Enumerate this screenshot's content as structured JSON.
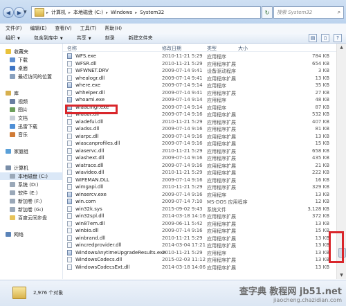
{
  "address": {
    "crumbs": [
      "计算机",
      "本地磁盘 (C:)",
      "Windows",
      "System32"
    ],
    "search_placeholder": "搜索 System32"
  },
  "menu": [
    "文件(F)",
    "编辑(E)",
    "查看(V)",
    "工具(T)",
    "帮助(H)"
  ],
  "toolbar": {
    "organize": "组织",
    "include": "包含到库中",
    "share": "共享",
    "burn": "刻录",
    "new_folder": "新建文件夹"
  },
  "nav": {
    "favorites": "收藏夹",
    "download": "下载",
    "desktop": "桌面",
    "recent": "最近访问的位置",
    "library": "库",
    "video": "视频",
    "pictures": "图片",
    "docs": "文档",
    "thunder": "迅雷下载",
    "music": "音乐",
    "homegroup": "家庭组",
    "computer": "计算机",
    "drive_c": "本地磁盘 (C:)",
    "drive_d": "系统 (D:)",
    "drive_e": "软件 (E:)",
    "drive_f": "新加卷 (F:)",
    "drive_g": "新加卷 (G:)",
    "baidu": "百度云同步盘",
    "network": "网络"
  },
  "columns": {
    "name": "名称",
    "date": "修改日期",
    "type": "类型",
    "size": "大小"
  },
  "files": [
    {
      "name": "WFS.exe",
      "date": "2010-11-21 5:29",
      "type": "应用程序",
      "size": "784 KB"
    },
    {
      "name": "WFSR.dll",
      "date": "2010-11-21 5:29",
      "type": "应用程序扩展",
      "size": "654 KB"
    },
    {
      "name": "WFWNET.DRV",
      "date": "2009-07-14 9:41",
      "type": "设备驱动程序",
      "size": "3 KB"
    },
    {
      "name": "whealogr.dll",
      "date": "2009-07-14 9:41",
      "type": "应用程序扩展",
      "size": "13 KB"
    },
    {
      "name": "where.exe",
      "date": "2009-07-14 9:14",
      "type": "应用程序",
      "size": "35 KB"
    },
    {
      "name": "whhelper.dll",
      "date": "2009-07-14 9:41",
      "type": "应用程序扩展",
      "size": "27 KB"
    },
    {
      "name": "whoami.exe",
      "date": "2009-07-14 9:14",
      "type": "应用程序",
      "size": "48 KB"
    },
    {
      "name": "wiaacmgr.exe",
      "date": "2009-07-14 9:14",
      "type": "应用程序",
      "size": "87 KB"
    },
    {
      "name": "wiaaut.dll",
      "date": "2009-07-14 9:16",
      "type": "应用程序扩展",
      "size": "532 KB"
    },
    {
      "name": "wiadefui.dll",
      "date": "2010-11-21 5:29",
      "type": "应用程序扩展",
      "size": "407 KB"
    },
    {
      "name": "wiadss.dll",
      "date": "2009-07-14 9:16",
      "type": "应用程序扩展",
      "size": "81 KB"
    },
    {
      "name": "wiarpc.dll",
      "date": "2009-07-14 9:16",
      "type": "应用程序扩展",
      "size": "13 KB"
    },
    {
      "name": "wiascanprofiles.dll",
      "date": "2009-07-14 9:16",
      "type": "应用程序扩展",
      "size": "15 KB"
    },
    {
      "name": "wiaservc.dll",
      "date": "2010-11-21 5:29",
      "type": "应用程序扩展",
      "size": "658 KB"
    },
    {
      "name": "wiashext.dll",
      "date": "2009-07-14 9:16",
      "type": "应用程序扩展",
      "size": "435 KB"
    },
    {
      "name": "wiatrace.dll",
      "date": "2009-07-14 9:16",
      "type": "应用程序扩展",
      "size": "21 KB"
    },
    {
      "name": "wiavideo.dll",
      "date": "2010-11-21 5:29",
      "type": "应用程序扩展",
      "size": "222 KB"
    },
    {
      "name": "WIFEMAN.DLL",
      "date": "2009-07-14 9:16",
      "type": "应用程序扩展",
      "size": "16 KB"
    },
    {
      "name": "wimgapi.dll",
      "date": "2010-11-21 5:29",
      "type": "应用程序扩展",
      "size": "329 KB"
    },
    {
      "name": "winsercv.exe",
      "date": "2009-07-14 9:16",
      "type": "应用程序",
      "size": "13 KB"
    },
    {
      "name": "win.com",
      "date": "2009-07-14 7:10",
      "type": "MS-DOS 应用程序",
      "size": "12 KB"
    },
    {
      "name": "win32k.sys",
      "date": "2015-09-02 9:43",
      "type": "系统文件",
      "size": "3,128 KB"
    },
    {
      "name": "win32spl.dll",
      "date": "2014-03-18 14:16",
      "type": "应用程序扩展",
      "size": "372 KB"
    },
    {
      "name": "win87em.dll",
      "date": "2009-06-11 5:42",
      "type": "应用程序扩展",
      "size": "13 KB"
    },
    {
      "name": "winbio.dll",
      "date": "2009-07-14 9:16",
      "type": "应用程序扩展",
      "size": "15 KB"
    },
    {
      "name": "winbrand.dll",
      "date": "2010-11-21 5:29",
      "type": "应用程序扩展",
      "size": "13 KB"
    },
    {
      "name": "wincredprovider.dll",
      "date": "2014-03-04 17:21",
      "type": "应用程序扩展",
      "size": "13 KB"
    },
    {
      "name": "WindowsAnytimeUpgradeResults.exe",
      "date": "2010-11-21 5:29",
      "type": "应用程序",
      "size": "13 KB"
    },
    {
      "name": "WindowsCodecs.dll",
      "date": "2015-02-03 11:12",
      "type": "应用程序扩展",
      "size": "13 KB"
    },
    {
      "name": "WindowsCodecsExt.dll",
      "date": "2014-03-18 14:06",
      "type": "应用程序扩展",
      "size": "13 KB"
    }
  ],
  "status": {
    "count": "2,976 个对象"
  },
  "watermark": {
    "line1": "查字典 教程网 jb51.net",
    "line2": "jiaocheng.chazidian.com"
  }
}
